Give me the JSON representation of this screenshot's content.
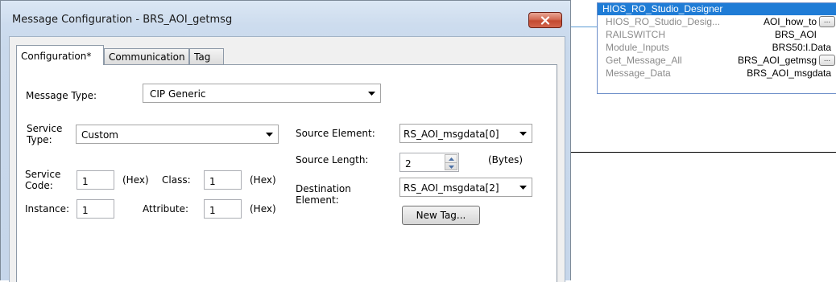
{
  "dialog": {
    "title": "Message Configuration - BRS_AOI_getmsg",
    "tabs": [
      {
        "label": "Configuration*"
      },
      {
        "label": "Communication"
      },
      {
        "label": "Tag"
      }
    ]
  },
  "config": {
    "message_type_label": "Message Type:",
    "message_type_value": "CIP Generic",
    "service_type_label_1": "Service",
    "service_type_label_2": "Type:",
    "service_type_value": "Custom",
    "service_code_label_1": "Service",
    "service_code_label_2": "Code:",
    "service_code_value": "1",
    "hex_label_1": "(Hex)",
    "class_label": "Class:",
    "class_value": "1",
    "hex_label_2": "(Hex)",
    "instance_label": "Instance:",
    "instance_value": "1",
    "attribute_label": "Attribute:",
    "attribute_value": "1",
    "hex_label_3": "(Hex)",
    "source_element_label": "Source Element:",
    "source_element_value": "RS_AOI_msgdata[0]",
    "source_length_label": "Source Length:",
    "source_length_value": "2",
    "bytes_label": "(Bytes)",
    "destination_label_1": "Destination",
    "destination_label_2": "Element:",
    "destination_value": "RS_AOI_msgdata[2]",
    "new_tag_button": "New Tag..."
  },
  "tag_block": {
    "title": "HIOS_RO_Studio_Designer",
    "rows": [
      {
        "name": "HIOS_RO_Studio_Desig...",
        "value": "AOI_how_to",
        "has_button": true
      },
      {
        "name": "RAILSWITCH",
        "value": "BRS_AOI",
        "has_button": false
      },
      {
        "name": "Module_Inputs",
        "value": "BRS50:I.Data",
        "has_button": false
      },
      {
        "name": "Get_Message_All",
        "value": "BRS_AOI_getmsg",
        "has_button": true
      },
      {
        "name": "Message_Data",
        "value": "BRS_AOI_msgdata",
        "has_button": false
      }
    ],
    "button_label": "..."
  },
  "colors": {
    "accent_blue": "#1f7cd6",
    "close_red": "#c44a30"
  }
}
